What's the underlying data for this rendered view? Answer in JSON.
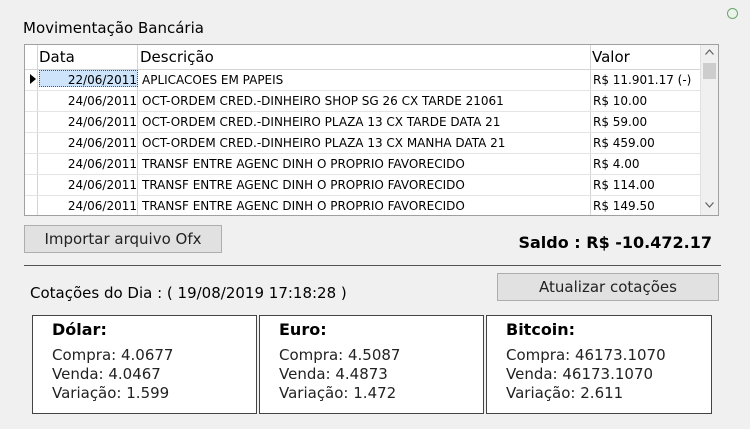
{
  "movimentacao": {
    "title": "Movimentação Bancária",
    "columns": [
      "Data",
      "Descrição",
      "Valor"
    ],
    "rows": [
      {
        "date": "22/06/2011",
        "desc": "APLICACOES EM PAPEIS",
        "val": "R$ 11.901.17 (-)"
      },
      {
        "date": "24/06/2011",
        "desc": "OCT-ORDEM CRED.-DINHEIRO SHOP SG 26 CX TARDE 21061",
        "val": "R$ 10.00"
      },
      {
        "date": "24/06/2011",
        "desc": "OCT-ORDEM CRED.-DINHEIRO PLAZA 13 CX TARDE DATA 21",
        "val": "R$ 59.00"
      },
      {
        "date": "24/06/2011",
        "desc": "OCT-ORDEM CRED.-DINHEIRO PLAZA 13 CX MANHA DATA 21",
        "val": "R$ 459.00"
      },
      {
        "date": "24/06/2011",
        "desc": "TRANSF ENTRE AGENC DINH O PROPRIO FAVORECIDO",
        "val": "R$ 4.00"
      },
      {
        "date": "24/06/2011",
        "desc": "TRANSF ENTRE AGENC DINH O PROPRIO FAVORECIDO",
        "val": "R$ 114.00"
      },
      {
        "date": "24/06/2011",
        "desc": "TRANSF ENTRE AGENC DINH O PROPRIO FAVORECIDO",
        "val": "R$ 149.50"
      }
    ]
  },
  "import_button": "Importar arquivo Ofx",
  "saldo": "Saldo : R$ -10.472.17",
  "cotacoes": {
    "label": "Cotações do Dia :  ( 19/08/2019 17:18:28 )",
    "update_button": "Atualizar cotações",
    "cards": [
      {
        "title": "Dólar:",
        "compra": "Compra: 4.0677",
        "venda": "Venda: 4.0467",
        "variacao": "Variação: 1.599"
      },
      {
        "title": "Euro:",
        "compra": "Compra: 4.5087",
        "venda": "Venda: 4.4873",
        "variacao": "Variação: 1.472"
      },
      {
        "title": "Bitcoin:",
        "compra": "Compra: 46173.1070",
        "venda": "Venda: 46173.1070",
        "variacao": "Variação: 2.611"
      }
    ]
  },
  "icons": {
    "status": "status-indicator-icon",
    "scroll_up": "chevron-up-icon",
    "scroll_down": "chevron-down-icon",
    "row_pointer": "row-pointer-icon"
  }
}
